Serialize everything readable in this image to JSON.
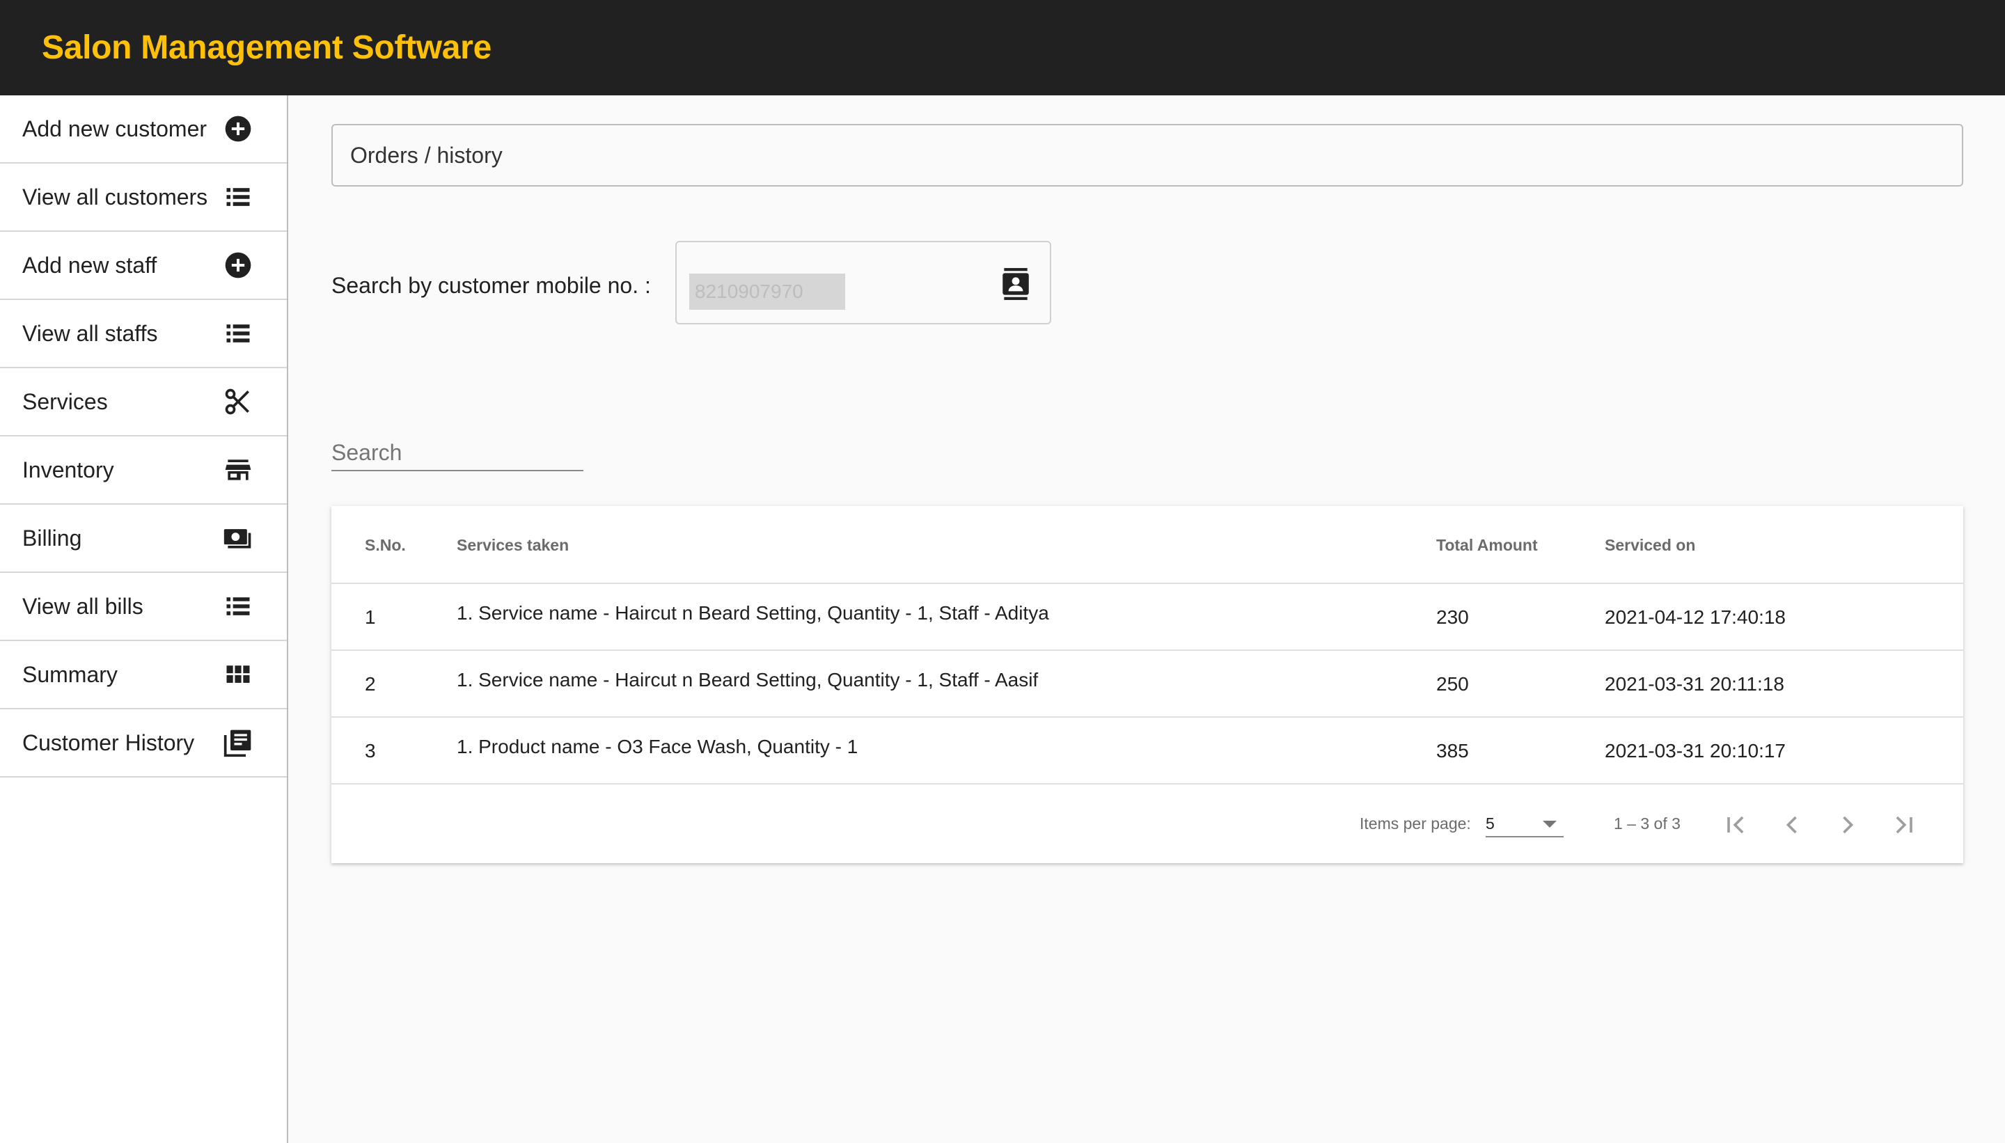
{
  "app": {
    "title": "Salon Management Software"
  },
  "sidebar": {
    "items": [
      {
        "label": "Add new customer",
        "icon": "add-circle-icon"
      },
      {
        "label": "View all customers",
        "icon": "list-icon"
      },
      {
        "label": "Add new staff",
        "icon": "add-circle-icon"
      },
      {
        "label": "View all staffs",
        "icon": "list-icon"
      },
      {
        "label": "Services",
        "icon": "scissors-icon"
      },
      {
        "label": "Inventory",
        "icon": "store-icon"
      },
      {
        "label": "Billing",
        "icon": "money-icon"
      },
      {
        "label": "View all bills",
        "icon": "list-icon"
      },
      {
        "label": "Summary",
        "icon": "grid-icon"
      },
      {
        "label": "Customer History",
        "icon": "library-books-icon"
      }
    ]
  },
  "breadcrumb": {
    "text": "Orders / history"
  },
  "mobile_search": {
    "label": "Search by customer mobile no. :",
    "value": "8210907970",
    "icon": "contact-icon"
  },
  "filter": {
    "placeholder": "Search"
  },
  "table": {
    "headers": [
      "S.No.",
      "Services taken",
      "Total Amount",
      "Serviced on"
    ],
    "rows": [
      {
        "sno": "1",
        "services": "1. Service name - Haircut n Beard Setting, Quantity - 1, Staff - Aditya",
        "amount": "230",
        "date": "2021-04-12 17:40:18"
      },
      {
        "sno": "2",
        "services": "1. Service name - Haircut n Beard Setting, Quantity - 1, Staff - Aasif",
        "amount": "250",
        "date": "2021-03-31 20:11:18"
      },
      {
        "sno": "3",
        "services": "1. Product name - O3 Face Wash, Quantity - 1",
        "amount": "385",
        "date": "2021-03-31 20:10:17"
      }
    ]
  },
  "paginator": {
    "items_per_page_label": "Items per page:",
    "items_per_page": "5",
    "range_label": "1 – 3 of 3"
  },
  "colors": {
    "topbar": "#212121",
    "title": "#ffc107",
    "background": "#fafafa"
  }
}
